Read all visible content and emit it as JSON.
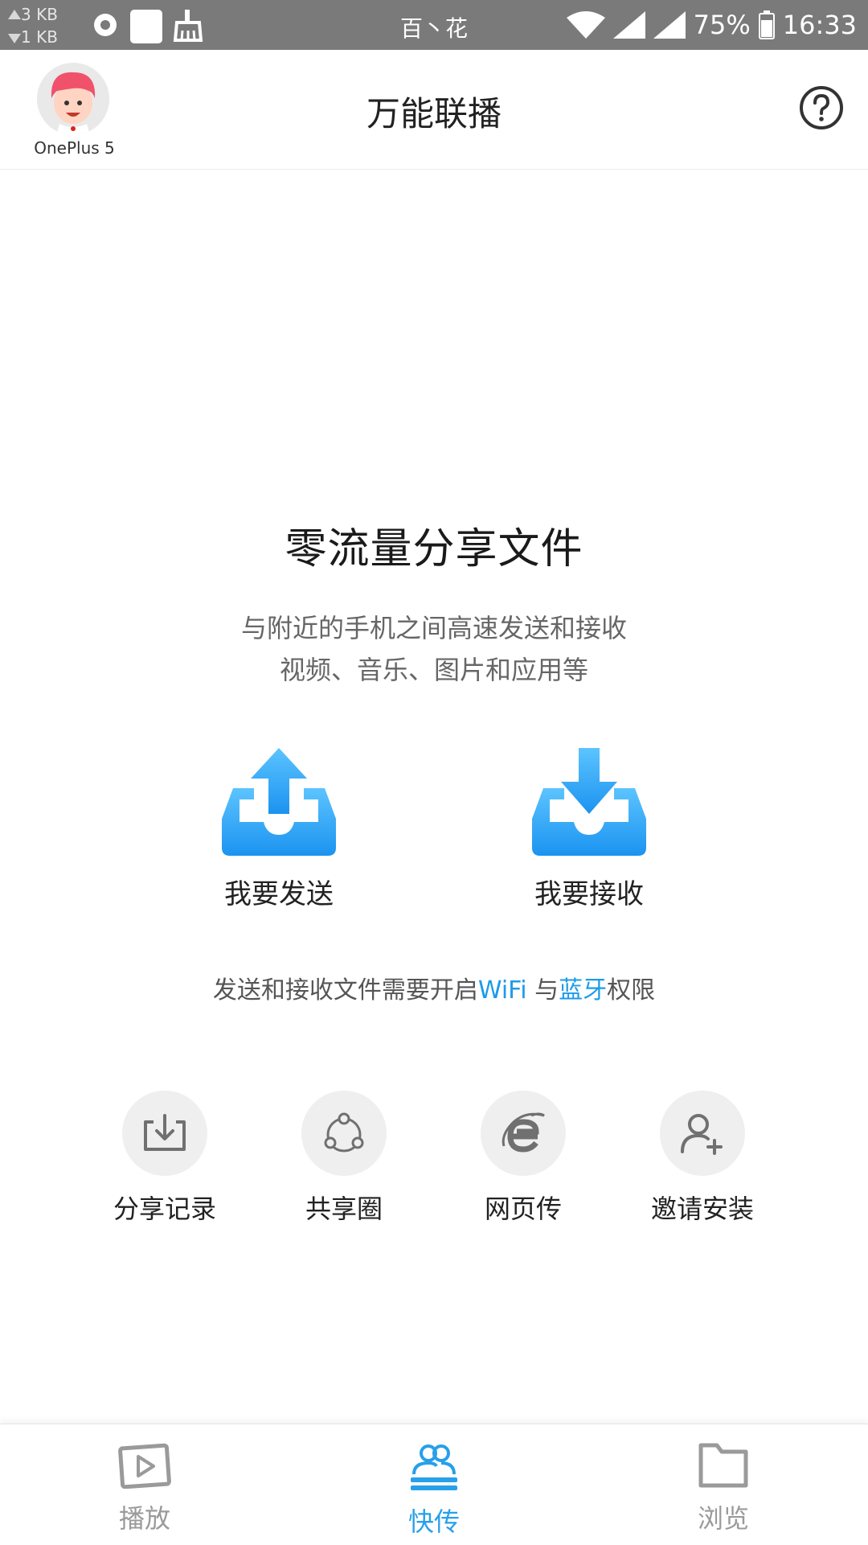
{
  "status_bar": {
    "upload_speed": "3 KB",
    "download_speed": "1 KB",
    "center_text": "百丶花",
    "battery": "75%",
    "time": "16:33"
  },
  "header": {
    "device_name": "OnePlus 5",
    "title": "万能联播"
  },
  "main": {
    "headline": "零流量分享文件",
    "subtitle_line1": "与附近的手机之间高速发送和接收",
    "subtitle_line2": "视频、音乐、图片和应用等",
    "send_label": "我要发送",
    "receive_label": "我要接收",
    "permission": {
      "prefix": "发送和接收文件需要开启",
      "wifi": "WiFi",
      "and": " 与",
      "bluetooth": "蓝牙",
      "suffix": "权限"
    },
    "tools": [
      {
        "label": "分享记录",
        "icon": "download-tray-icon"
      },
      {
        "label": "共享圈",
        "icon": "share-circle-icon"
      },
      {
        "label": "网页传",
        "icon": "browser-e-icon"
      },
      {
        "label": "邀请安装",
        "icon": "add-user-icon"
      }
    ]
  },
  "bottom_nav": [
    {
      "label": "播放",
      "icon": "play-icon",
      "active": false
    },
    {
      "label": "快传",
      "icon": "users-icon",
      "active": true
    },
    {
      "label": "浏览",
      "icon": "folder-icon",
      "active": false
    }
  ],
  "colors": {
    "accent": "#27a0ea",
    "status_bar": "#7a7a7a",
    "icon_gray": "#707070"
  }
}
